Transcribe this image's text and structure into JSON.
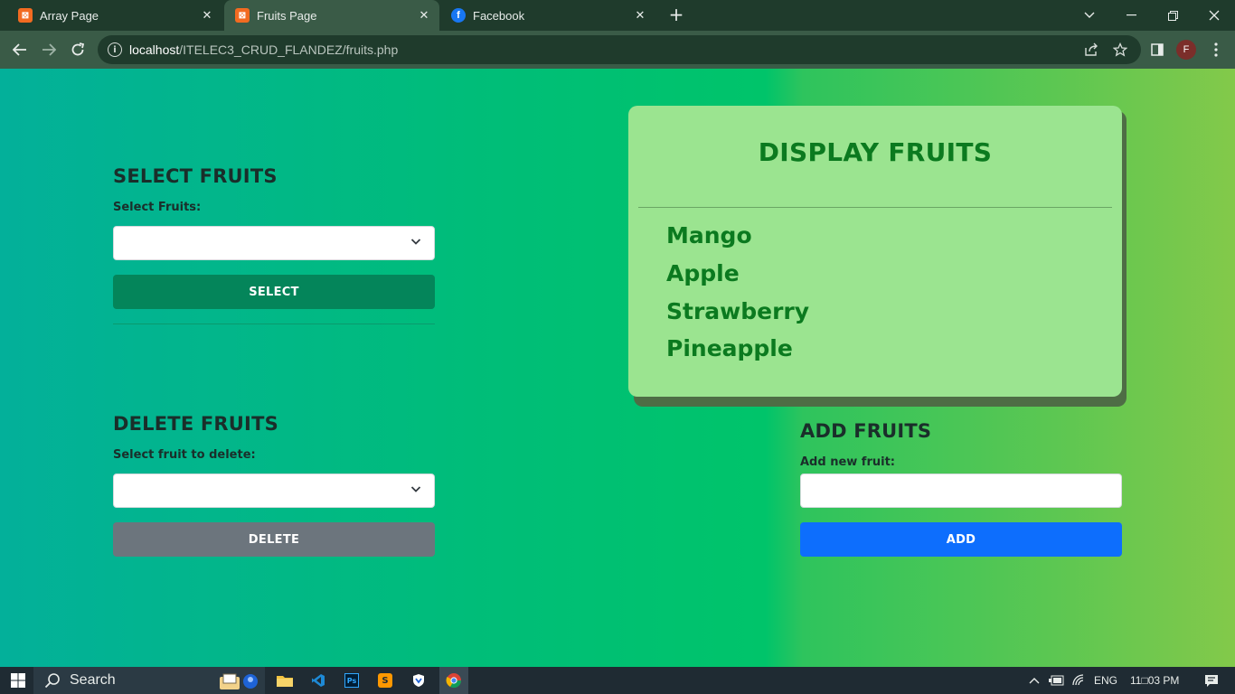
{
  "browser": {
    "tabs": [
      {
        "title": "Array Page",
        "icon": "xampp-icon",
        "active": false
      },
      {
        "title": "Fruits Page",
        "icon": "xampp-icon",
        "active": true
      },
      {
        "title": "Facebook",
        "icon": "facebook-icon",
        "active": false
      }
    ],
    "url_host": "localhost",
    "url_path": "/ITELEC3_CRUD_FLANDEZ/fruits.php",
    "profile_initial": "F"
  },
  "select_section": {
    "title": "SELECT FRUITS",
    "label": "Select Fruits:",
    "selected_value": "",
    "button_label": "SELECT"
  },
  "delete_section": {
    "title": "DELETE FRUITS",
    "label": "Select fruit to delete:",
    "selected_value": "",
    "button_label": "DELETE"
  },
  "display_section": {
    "title": "DISPLAY FRUITS",
    "fruits": [
      "Mango",
      "Apple",
      "Strawberry",
      "Pineapple"
    ]
  },
  "add_section": {
    "title": "ADD FRUITS",
    "label": "Add new fruit:",
    "input_value": "",
    "button_label": "ADD"
  },
  "taskbar": {
    "search_label": "Search",
    "language": "ENG",
    "time": "11□03 PM"
  },
  "colors": {
    "accent_green": "#04855a",
    "delete_gray": "#6c757d",
    "add_blue": "#0d6efd",
    "card_bg": "#9be490",
    "card_text": "#0b7a1f"
  }
}
